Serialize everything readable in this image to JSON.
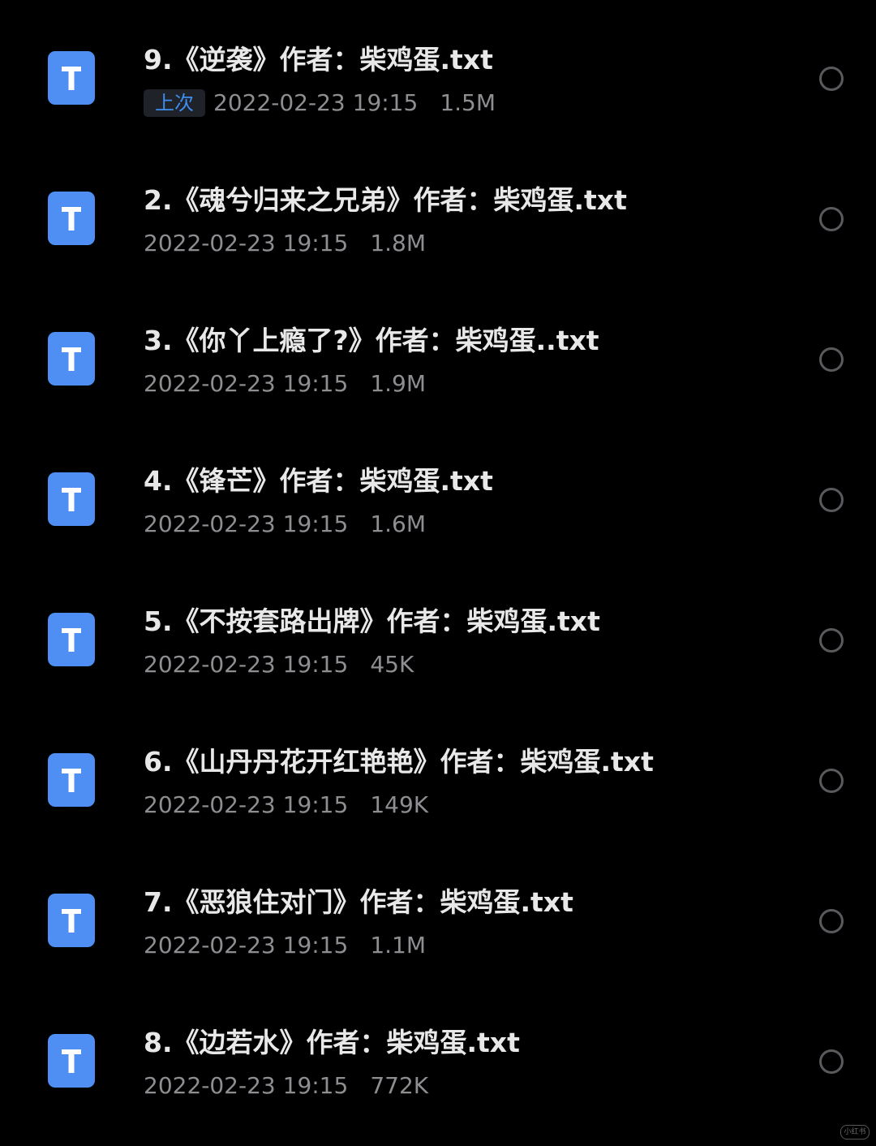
{
  "icon": "txt-file-icon",
  "icon_letter": "T",
  "colors": {
    "background": "#000000",
    "icon": "#4f8ff3",
    "title": "#e8e8e8",
    "meta": "#8e8e92",
    "badge_text": "#3d8ef0",
    "badge_bg": "#1f2228",
    "radio": "#5a5a5e"
  },
  "files": [
    {
      "name": "9.《逆袭》作者：柴鸡蛋.txt",
      "badge": "上次",
      "date": "2022-02-23 19:15",
      "size": "1.5M"
    },
    {
      "name": "2.《魂兮归来之兄弟》作者：柴鸡蛋.txt",
      "badge": "",
      "date": "2022-02-23 19:15",
      "size": "1.8M"
    },
    {
      "name": "3.《你丫上瘾了?》作者：柴鸡蛋..txt",
      "badge": "",
      "date": "2022-02-23 19:15",
      "size": "1.9M"
    },
    {
      "name": "4.《锋芒》作者：柴鸡蛋.txt",
      "badge": "",
      "date": "2022-02-23 19:15",
      "size": "1.6M"
    },
    {
      "name": "5.《不按套路出牌》作者：柴鸡蛋.txt",
      "badge": "",
      "date": "2022-02-23 19:15",
      "size": "45K"
    },
    {
      "name": "6.《山丹丹花开红艳艳》作者：柴鸡蛋.txt",
      "badge": "",
      "date": "2022-02-23 19:15",
      "size": "149K"
    },
    {
      "name": "7.《恶狼住对门》作者：柴鸡蛋.txt",
      "badge": "",
      "date": "2022-02-23 19:15",
      "size": "1.1M"
    },
    {
      "name": "8.《边若水》作者：柴鸡蛋.txt",
      "badge": "",
      "date": "2022-02-23 19:15",
      "size": "772K"
    }
  ],
  "watermark": "小红书"
}
